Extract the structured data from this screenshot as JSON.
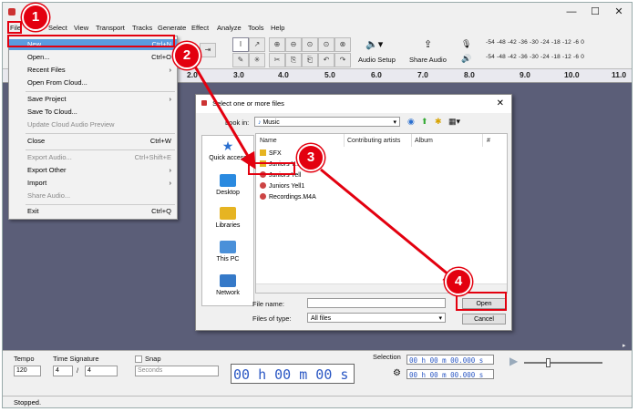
{
  "menubar": {
    "items": [
      "File",
      "Edit",
      "Select",
      "View",
      "Transport",
      "Tracks",
      "Generate",
      "Effect",
      "Analyze",
      "Tools",
      "Help"
    ]
  },
  "toolbar": {
    "audio_setup_label": "Audio Setup",
    "share_audio_label": "Share Audio",
    "meter_scale": "-54 -48 -42 -36 -30 -24 -18 -12 -6 0"
  },
  "ruler": {
    "ticks": [
      "2.0",
      "3.0",
      "4.0",
      "5.0",
      "6.0",
      "7.0",
      "8.0",
      "9.0",
      "10.0",
      "11.0"
    ]
  },
  "file_menu": {
    "items": [
      {
        "label": "New",
        "shortcut": "Ctrl+N",
        "state": "highlighted"
      },
      {
        "label": "Open...",
        "shortcut": "Ctrl+O",
        "state": "normal"
      },
      {
        "label": "Recent Files",
        "shortcut": "",
        "state": "submenu"
      },
      {
        "label": "Open From Cloud...",
        "shortcut": "",
        "state": "normal"
      },
      {
        "label": "Save Project",
        "shortcut": "",
        "state": "submenu"
      },
      {
        "label": "Save To Cloud...",
        "shortcut": "",
        "state": "normal"
      },
      {
        "label": "Update Cloud Audio Preview",
        "shortcut": "",
        "state": "disabled"
      },
      {
        "label": "Close",
        "shortcut": "Ctrl+W",
        "state": "normal"
      },
      {
        "label": "Export Audio...",
        "shortcut": "Ctrl+Shift+E",
        "state": "disabled"
      },
      {
        "label": "Export Other",
        "shortcut": "",
        "state": "submenu"
      },
      {
        "label": "Import",
        "shortcut": "",
        "state": "submenu"
      },
      {
        "label": "Share Audio...",
        "shortcut": "",
        "state": "disabled"
      },
      {
        "label": "Exit",
        "shortcut": "Ctrl+Q",
        "state": "normal"
      }
    ]
  },
  "dialog": {
    "title": "Select one or more files",
    "look_in_label": "Look in:",
    "look_in_value": "Music",
    "places": [
      "Quick access",
      "Desktop",
      "Libraries",
      "This PC",
      "Network"
    ],
    "columns": [
      "Name",
      "Contributing artists",
      "Album",
      "#"
    ],
    "files": [
      {
        "name": "SFX",
        "type": "folder"
      },
      {
        "name": "Juniors Y...",
        "type": "folder"
      },
      {
        "name": "Juniors Yell",
        "type": "audio"
      },
      {
        "name": "Juniors Yell1",
        "type": "audio"
      },
      {
        "name": "Recordings.M4A",
        "type": "audio"
      }
    ],
    "file_name_label": "File name:",
    "file_name_value": "",
    "file_type_label": "Files of type:",
    "file_type_value": "All files",
    "open_label": "Open",
    "cancel_label": "Cancel"
  },
  "bottom": {
    "tempo_label": "Tempo",
    "tempo_value": "120",
    "time_sig_label": "Time Signature",
    "time_sig_num": "4",
    "time_sig_sep": "/",
    "time_sig_den": "4",
    "snap_label": "Snap",
    "snap_unit": "Seconds",
    "big_time": "00 h 00 m 00 s",
    "selection_label": "Selection",
    "sel_start": "00 h 00 m 00.000 s",
    "sel_end": "00 h 00 m 00.000 s"
  },
  "status": {
    "text": "Stopped."
  },
  "annotations": {
    "step1": "1",
    "step2": "2",
    "step3": "3",
    "step4": "4",
    "color": "#e3000f"
  }
}
